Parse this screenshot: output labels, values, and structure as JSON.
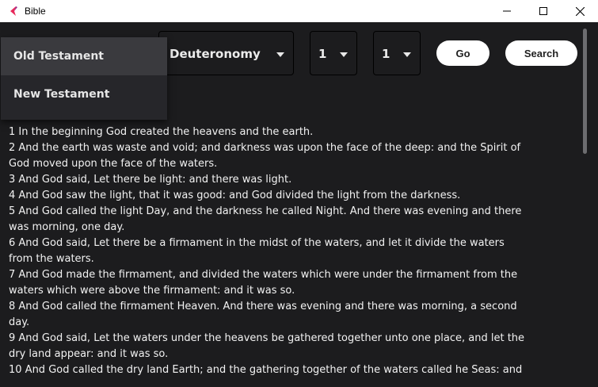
{
  "window": {
    "title": "Bible",
    "accent": "#e8295a"
  },
  "toolbar": {
    "book": "Deuteronomy",
    "chapter": "1",
    "verse": "1",
    "go_label": "Go",
    "search_label": "Search"
  },
  "menu": {
    "items": [
      {
        "label": "Old Testament",
        "highlighted": true
      },
      {
        "label": "New Testament",
        "highlighted": false
      }
    ]
  },
  "verses": [
    "1 In the beginning God created the heavens and the earth.",
    "2 And the earth was waste and void; and darkness was upon the face of the deep: and the Spirit of God moved upon the face of the waters.",
    "3 And God said, Let there be light: and there was light.",
    "4 And God saw the light, that it was good: and God divided the light from the darkness.",
    "5 And God called the light Day, and the darkness he called Night. And there was evening and there was morning, one day.",
    "6 And God said, Let there be a firmament in the midst of the waters, and let it divide the waters from the waters.",
    "7 And God made the firmament, and divided the waters which were under the firmament from the waters which were above the firmament: and it was so.",
    "8 And God called the firmament Heaven. And there was evening and there was morning, a second day.",
    "9 And God said, Let the waters under the heavens be gathered together unto one place, and let the dry land appear: and it was so.",
    "10 And God called the dry land Earth; and the gathering together of the waters called he Seas: and"
  ]
}
